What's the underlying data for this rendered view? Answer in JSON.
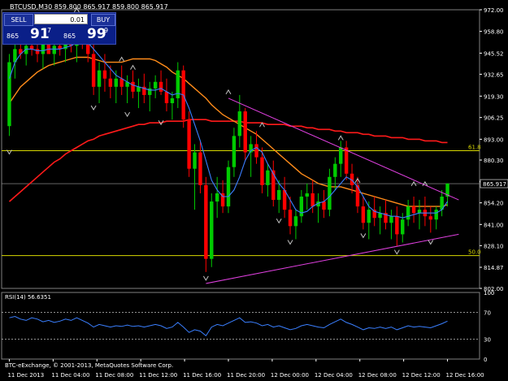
{
  "chart_title": "BTCUSD,M30  859.800 865.917 859.800 865.917",
  "trade_panel": {
    "sell_label": "SELL",
    "buy_label": "BUY",
    "lot_value": "0.01",
    "bid_small": "865",
    "bid_big": "91",
    "bid_sup": "7",
    "ask_small": "865",
    "ask_big": "99",
    "ask_sup": "9"
  },
  "copyright": "BTC-eExchange, © 2001-2013, MetaQuotes Software Corp.",
  "colors": {
    "background": "#000000",
    "bull": "#00cc00",
    "bear": "#ff0000",
    "ma_fast": "#3a7fff",
    "ma_mid": "#ff8c1a",
    "ma_slow": "#ff1a1a",
    "trendline": "#e040e0",
    "fibo": "#d8d800",
    "grid_text": "#ffffff",
    "rsi_line": "#3a7fff"
  },
  "chart_data": {
    "type": "candlestick",
    "symbol": "BTCUSD",
    "timeframe": "M30",
    "ylim": [
      802,
      972
    ],
    "y_ticks": [
      "972.00",
      "958.80",
      "945.52",
      "932.65",
      "919.30",
      "906.25",
      "893.00",
      "880.30",
      "867.06",
      "854.20",
      "841.00",
      "828.10",
      "814.87",
      "802.00"
    ],
    "x_ticks": [
      "11 Dec 2013",
      "11 Dec 04:00",
      "11 Dec 08:00",
      "11 Dec 12:00",
      "11 Dec 16:00",
      "11 Dec 20:00",
      "12 Dec 00:00",
      "12 Dec 04:00",
      "12 Dec 08:00",
      "12 Dec 12:00",
      "12 Dec 16:00"
    ],
    "current_price": "865.917",
    "candles": [
      [
        0,
        901,
        945,
        895,
        940
      ],
      [
        1,
        940,
        956,
        930,
        948
      ],
      [
        2,
        948,
        960,
        942,
        945
      ],
      [
        3,
        945,
        958,
        938,
        950
      ],
      [
        4,
        950,
        962,
        944,
        948
      ],
      [
        5,
        948,
        958,
        940,
        945
      ],
      [
        6,
        945,
        955,
        936,
        952
      ],
      [
        7,
        952,
        962,
        946,
        945
      ],
      [
        8,
        945,
        956,
        938,
        950
      ],
      [
        9,
        950,
        962,
        944,
        948
      ],
      [
        10,
        948,
        958,
        940,
        955
      ],
      [
        11,
        955,
        965,
        946,
        950
      ],
      [
        12,
        950,
        968,
        940,
        960
      ],
      [
        13,
        960,
        966,
        948,
        952
      ],
      [
        14,
        952,
        960,
        940,
        945
      ],
      [
        15,
        945,
        952,
        920,
        925
      ],
      [
        16,
        925,
        940,
        915,
        935
      ],
      [
        17,
        935,
        945,
        922,
        930
      ],
      [
        18,
        930,
        938,
        918,
        925
      ],
      [
        19,
        925,
        935,
        915,
        930
      ],
      [
        20,
        930,
        938,
        920,
        925
      ],
      [
        21,
        925,
        932,
        915,
        928
      ],
      [
        22,
        928,
        935,
        918,
        922
      ],
      [
        23,
        922,
        930,
        912,
        925
      ],
      [
        24,
        925,
        933,
        915,
        920
      ],
      [
        25,
        920,
        928,
        910,
        924
      ],
      [
        26,
        924,
        932,
        918,
        928
      ],
      [
        27,
        928,
        935,
        920,
        922
      ],
      [
        28,
        922,
        930,
        910,
        915
      ],
      [
        29,
        915,
        922,
        905,
        918
      ],
      [
        30,
        918,
        940,
        912,
        935
      ],
      [
        31,
        935,
        938,
        900,
        905
      ],
      [
        32,
        905,
        910,
        870,
        875
      ],
      [
        33,
        875,
        890,
        850,
        885
      ],
      [
        34,
        885,
        892,
        860,
        865
      ],
      [
        35,
        865,
        870,
        812,
        820
      ],
      [
        36,
        820,
        860,
        815,
        855
      ],
      [
        37,
        855,
        870,
        845,
        860
      ],
      [
        38,
        860,
        868,
        848,
        852
      ],
      [
        39,
        852,
        880,
        848,
        876
      ],
      [
        40,
        876,
        900,
        870,
        895
      ],
      [
        41,
        895,
        920,
        888,
        910
      ],
      [
        42,
        910,
        912,
        880,
        885
      ],
      [
        43,
        885,
        895,
        870,
        890
      ],
      [
        44,
        890,
        898,
        878,
        882
      ],
      [
        45,
        882,
        888,
        860,
        865
      ],
      [
        46,
        865,
        878,
        858,
        874
      ],
      [
        47,
        874,
        880,
        852,
        856
      ],
      [
        48,
        856,
        868,
        848,
        862
      ],
      [
        49,
        862,
        870,
        845,
        850
      ],
      [
        50,
        850,
        858,
        835,
        840
      ],
      [
        51,
        840,
        850,
        832,
        846
      ],
      [
        52,
        846,
        862,
        842,
        858
      ],
      [
        53,
        858,
        866,
        850,
        860
      ],
      [
        54,
        860,
        868,
        848,
        852
      ],
      [
        55,
        852,
        860,
        842,
        855
      ],
      [
        56,
        855,
        862,
        845,
        850
      ],
      [
        57,
        850,
        875,
        846,
        870
      ],
      [
        58,
        870,
        882,
        862,
        878
      ],
      [
        59,
        878,
        892,
        870,
        888
      ],
      [
        60,
        888,
        892,
        868,
        872
      ],
      [
        61,
        872,
        878,
        860,
        865
      ],
      [
        62,
        865,
        870,
        848,
        852
      ],
      [
        63,
        852,
        858,
        838,
        842
      ],
      [
        64,
        842,
        855,
        832,
        850
      ],
      [
        65,
        850,
        858,
        840,
        845
      ],
      [
        66,
        845,
        852,
        835,
        848
      ],
      [
        67,
        848,
        856,
        838,
        842
      ],
      [
        68,
        842,
        850,
        832,
        846
      ],
      [
        69,
        846,
        852,
        828,
        835
      ],
      [
        70,
        835,
        848,
        830,
        844
      ],
      [
        71,
        844,
        856,
        840,
        852
      ],
      [
        72,
        852,
        858,
        842,
        848
      ],
      [
        73,
        848,
        856,
        838,
        850
      ],
      [
        74,
        850,
        858,
        840,
        846
      ],
      [
        75,
        846,
        852,
        836,
        844
      ],
      [
        76,
        844,
        852,
        838,
        850
      ],
      [
        77,
        850,
        862,
        846,
        858
      ],
      [
        78,
        858,
        866,
        852,
        866
      ]
    ],
    "ma_fast": [
      930,
      940,
      945,
      948,
      948,
      947,
      947,
      948,
      948,
      948,
      949,
      950,
      952,
      953,
      952,
      948,
      944,
      940,
      936,
      932,
      930,
      928,
      926,
      925,
      924,
      923,
      923,
      924,
      922,
      920,
      921,
      920,
      912,
      902,
      892,
      880,
      868,
      862,
      858,
      858,
      862,
      870,
      880,
      886,
      888,
      885,
      878,
      872,
      866,
      862,
      856,
      850,
      848,
      849,
      852,
      854,
      855,
      858,
      862,
      866,
      870,
      868,
      864,
      858,
      852,
      849,
      848,
      847,
      846,
      846,
      845,
      846,
      847,
      848,
      848,
      848,
      848,
      850,
      855
    ],
    "ma_mid": [
      915,
      920,
      925,
      928,
      931,
      934,
      936,
      938,
      939,
      940,
      941,
      942,
      943,
      943,
      943,
      942,
      941,
      940,
      940,
      940,
      940,
      941,
      942,
      942,
      942,
      942,
      941,
      939,
      937,
      934,
      932,
      930,
      927,
      924,
      921,
      918,
      914,
      911,
      908,
      906,
      904,
      902,
      900,
      898,
      896,
      893,
      890,
      887,
      884,
      881,
      878,
      875,
      872,
      870,
      868,
      866,
      865,
      864,
      864,
      864,
      863,
      862,
      861,
      860,
      859,
      858,
      857,
      856,
      855,
      854,
      853,
      852,
      852,
      852,
      852,
      852,
      852,
      852,
      853
    ],
    "ma_slow": [
      855,
      858,
      861,
      864,
      867,
      870,
      873,
      876,
      879,
      881,
      884,
      886,
      888,
      890,
      892,
      893,
      895,
      896,
      897,
      898,
      899,
      900,
      901,
      902,
      902,
      903,
      903,
      903,
      904,
      904,
      904,
      904,
      905,
      905,
      905,
      905,
      904,
      904,
      904,
      904,
      904,
      904,
      903,
      903,
      903,
      903,
      902,
      902,
      902,
      902,
      901,
      901,
      901,
      900,
      900,
      899,
      899,
      899,
      898,
      898,
      897,
      897,
      897,
      896,
      896,
      895,
      895,
      895,
      894,
      894,
      894,
      893,
      893,
      893,
      892,
      892,
      892,
      891,
      891
    ],
    "rsi": {
      "label": "RSI(14) 56.6351",
      "ylim": [
        0,
        100
      ],
      "levels": [
        70,
        30
      ],
      "tick_labels": [
        "100",
        "70",
        "30",
        "0"
      ],
      "values": [
        62,
        64,
        60,
        58,
        62,
        60,
        56,
        58,
        55,
        57,
        60,
        58,
        62,
        58,
        54,
        48,
        52,
        50,
        48,
        50,
        49,
        51,
        49,
        50,
        48,
        50,
        52,
        50,
        46,
        48,
        55,
        48,
        40,
        44,
        42,
        35,
        48,
        52,
        50,
        54,
        58,
        62,
        55,
        56,
        54,
        50,
        52,
        48,
        50,
        47,
        44,
        46,
        50,
        52,
        50,
        48,
        47,
        52,
        56,
        60,
        55,
        52,
        48,
        44,
        47,
        46,
        48,
        46,
        48,
        44,
        47,
        50,
        48,
        49,
        48,
        47,
        50,
        53,
        57
      ]
    },
    "fibo": [
      {
        "label": "61.8",
        "value": 886
      },
      {
        "label": "50.0",
        "value": 822
      }
    ],
    "trendlines": [
      {
        "from": [
          39,
          918
        ],
        "to": [
          80,
          856
        ]
      },
      {
        "from": [
          35,
          805
        ],
        "to": [
          80,
          835
        ]
      }
    ],
    "fractals_up": [
      [
        2,
        966
      ],
      [
        12,
        972
      ],
      [
        20,
        942
      ],
      [
        22,
        937
      ],
      [
        39,
        922
      ],
      [
        45,
        902
      ],
      [
        59,
        894
      ],
      [
        62,
        868
      ],
      [
        72,
        866
      ],
      [
        74,
        866
      ]
    ],
    "fractals_down": [
      [
        0,
        885
      ],
      [
        15,
        912
      ],
      [
        21,
        908
      ],
      [
        27,
        903
      ],
      [
        35,
        808
      ],
      [
        48,
        843
      ],
      [
        50,
        830
      ],
      [
        63,
        834
      ],
      [
        69,
        824
      ],
      [
        75,
        830
      ]
    ]
  }
}
